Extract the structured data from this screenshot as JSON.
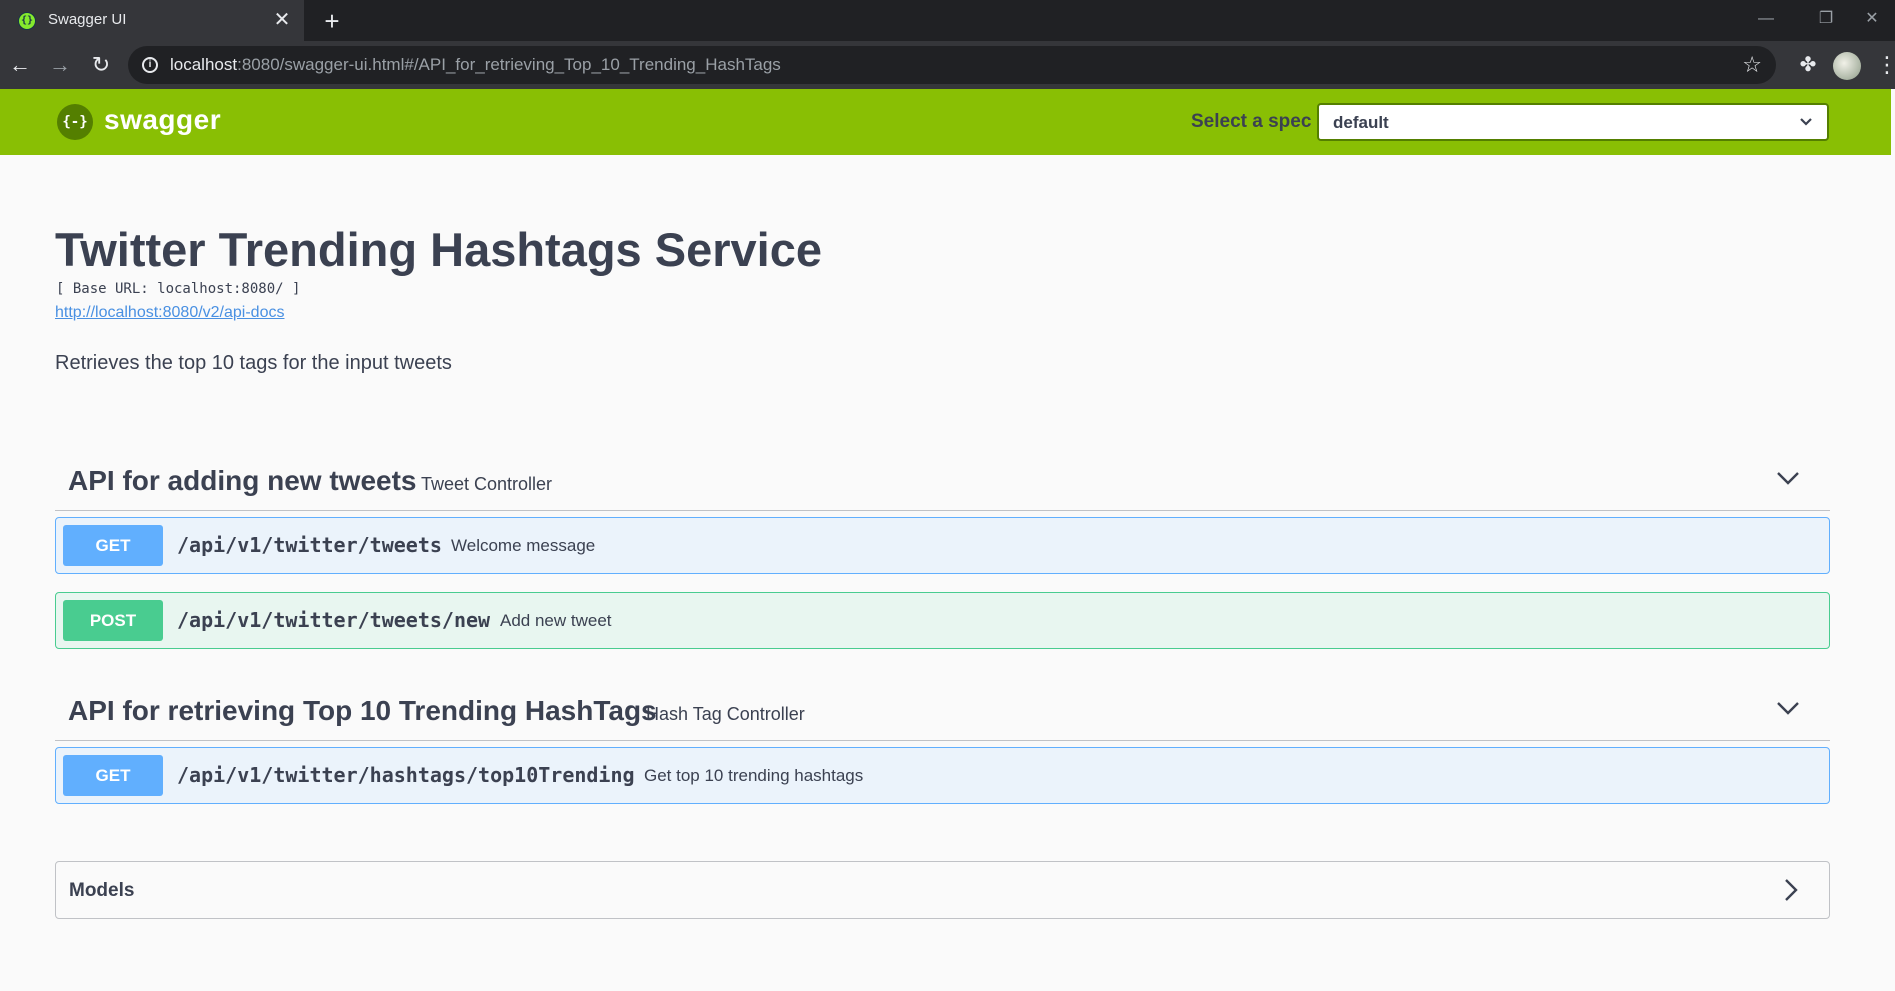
{
  "browser": {
    "tab_title": "Swagger UI",
    "url_host": "localhost",
    "url_rest": ":8080/swagger-ui.html#/API_for_retrieving_Top_10_Trending_HashTags"
  },
  "topbar": {
    "logo_mark": "{-}",
    "logo_text": "swagger",
    "spec_label": "Select a spec",
    "spec_value": "default"
  },
  "info": {
    "title": "Twitter Trending Hashtags Service",
    "base_url": "[ Base URL: localhost:8080/ ]",
    "api_docs_link": "http://localhost:8080/v2/api-docs",
    "description": "Retrieves the top 10 tags for the input tweets"
  },
  "tags": [
    {
      "name": "API for adding new tweets",
      "description": "Tweet Controller",
      "operations": [
        {
          "method": "GET",
          "path": "/api/v1/twitter/tweets",
          "summary": "Welcome message"
        },
        {
          "method": "POST",
          "path": "/api/v1/twitter/tweets/new",
          "summary": "Add new tweet"
        }
      ]
    },
    {
      "name": "API for retrieving Top 10 Trending HashTags",
      "description": "Hash Tag Controller",
      "operations": [
        {
          "method": "GET",
          "path": "/api/v1/twitter/hashtags/top10Trending",
          "summary": "Get top 10 trending hashtags"
        }
      ]
    }
  ],
  "models": {
    "title": "Models"
  },
  "colors": {
    "topbar": "#89bf04",
    "get": "#61affe",
    "post": "#49cc90",
    "text": "#3b4151"
  }
}
